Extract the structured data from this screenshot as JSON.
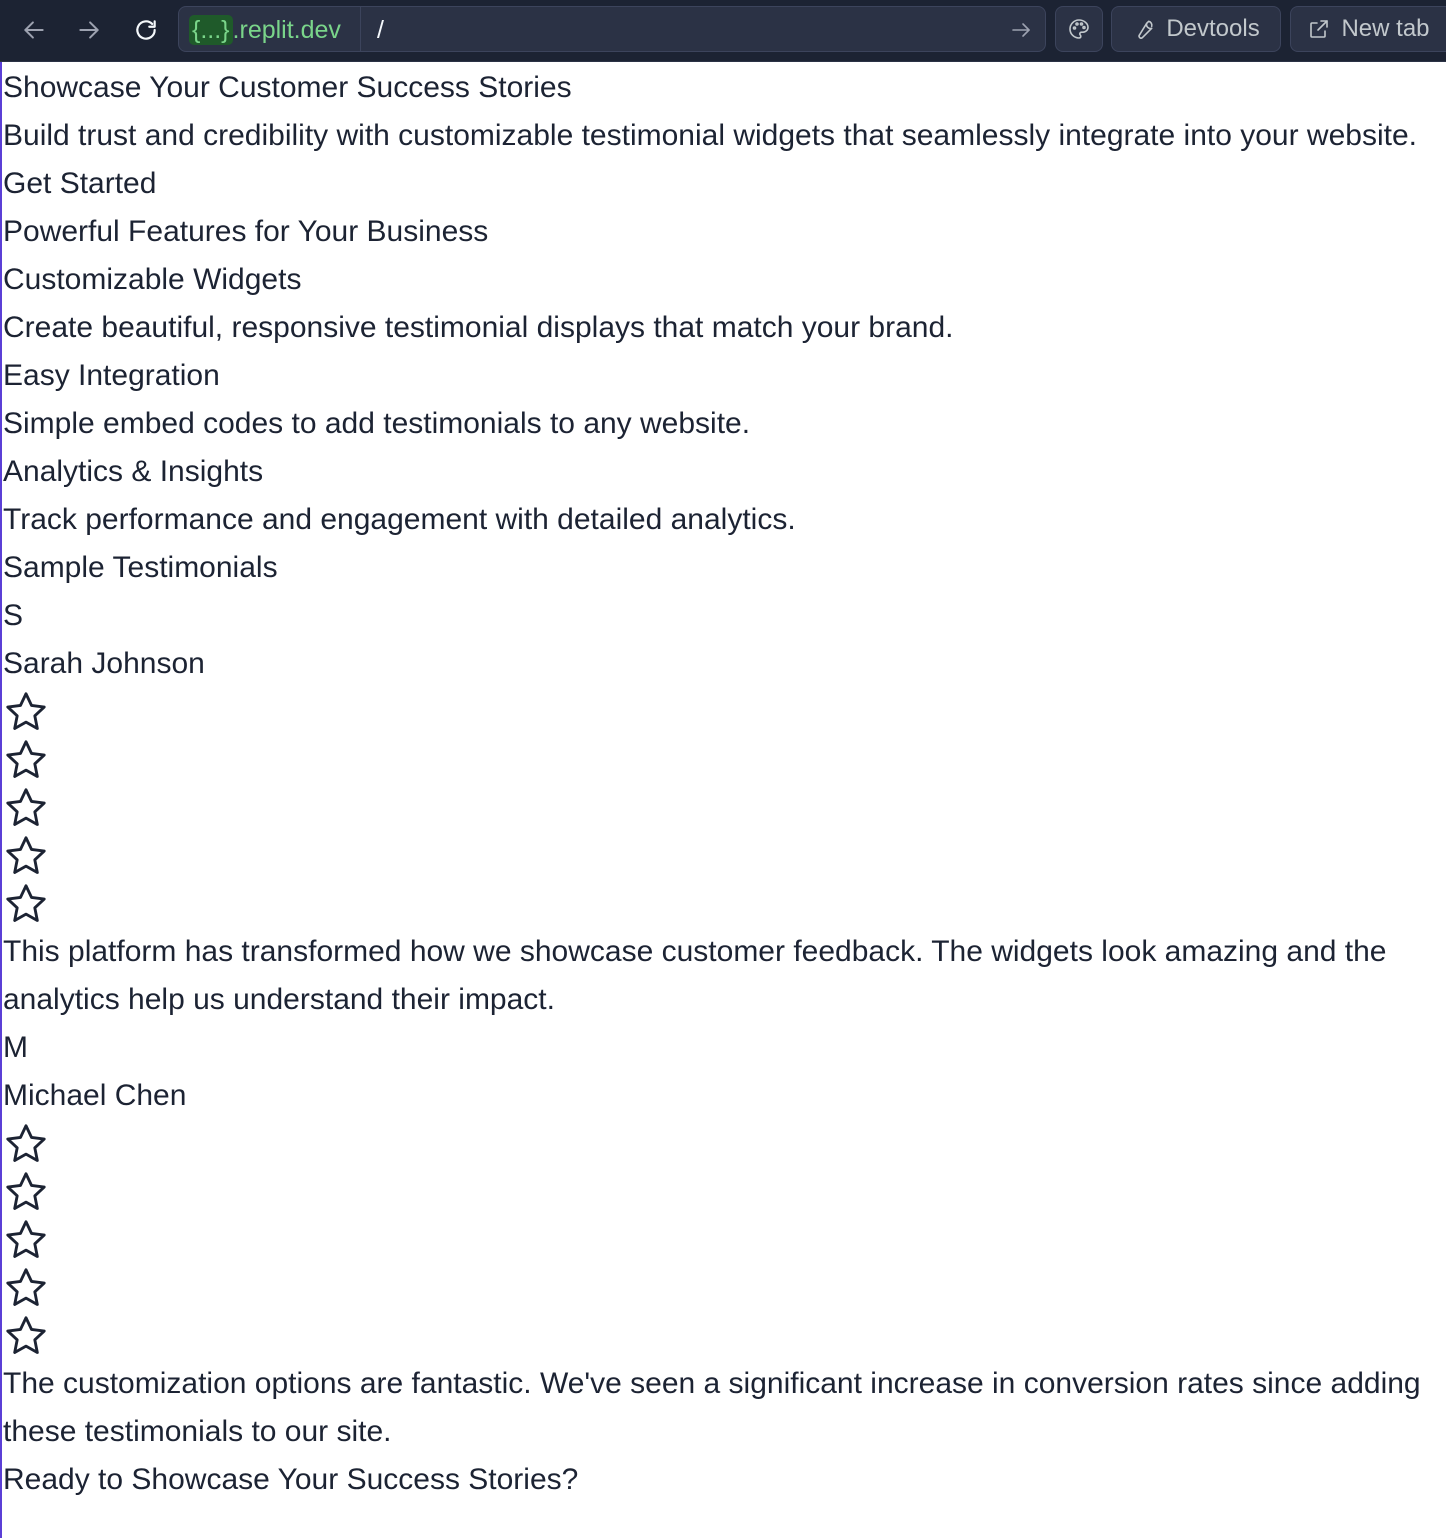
{
  "browser": {
    "url_chip": "{...}",
    "url_domain": ".replit.dev",
    "url_path": "/",
    "devtools_label": "Devtools",
    "new_tab_label": "New tab"
  },
  "hero": {
    "title": "Showcase Your Customer Success Stories",
    "subtitle": "Build trust and credibility with customizable testimonial widgets that seamlessly integrate into your website.",
    "cta": "Get Started"
  },
  "features": {
    "heading": "Powerful Features for Your Business",
    "items": [
      {
        "title": "Customizable Widgets",
        "description": "Create beautiful, responsive testimonial displays that match your brand."
      },
      {
        "title": "Easy Integration",
        "description": "Simple embed codes to add testimonials to any website."
      },
      {
        "title": "Analytics & Insights",
        "description": "Track performance and engagement with detailed analytics."
      }
    ]
  },
  "testimonials": {
    "heading": "Sample Testimonials",
    "items": [
      {
        "initial": "S",
        "name": "Sarah Johnson",
        "stars": 5,
        "quote": "This platform has transformed how we showcase customer feedback. The widgets look amazing and the analytics help us understand their impact."
      },
      {
        "initial": "M",
        "name": "Michael Chen",
        "stars": 5,
        "quote": "The customization options are fantastic. We've seen a significant increase in conversion rates since adding these testimonials to our site."
      }
    ]
  },
  "cta_section": {
    "heading": "Ready to Showcase Your Success Stories?"
  },
  "colors": {
    "toolbar_bg": "#1c2333",
    "url_domain": "#7ad58a",
    "accent_rule": "#5b3fd6",
    "text": "#1c2333"
  }
}
